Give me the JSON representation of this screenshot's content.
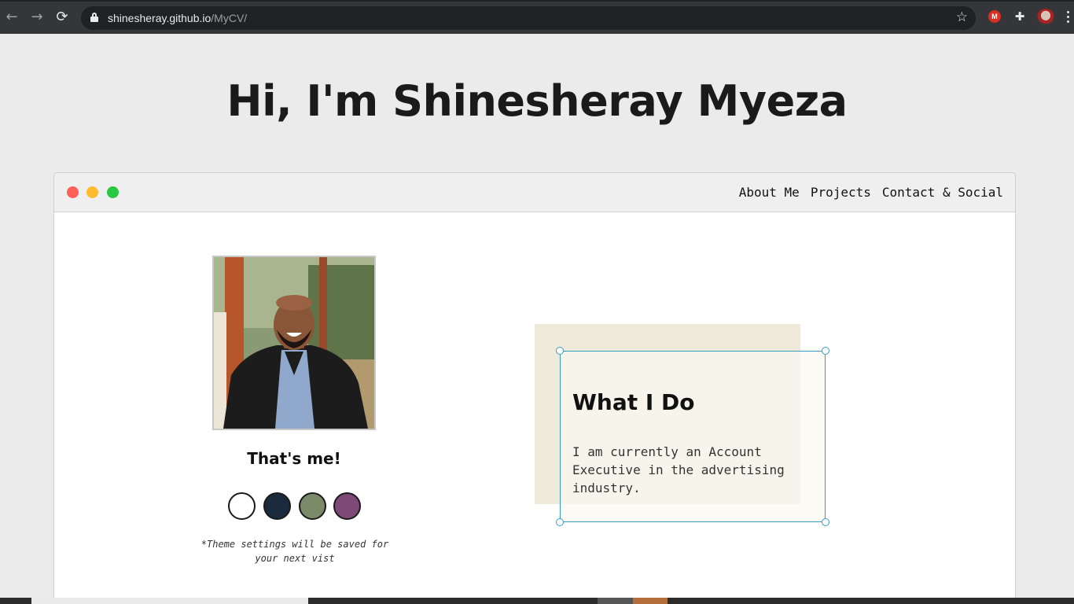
{
  "browser": {
    "url_host": "shinesheray.github.io",
    "url_path": "/MyCV/",
    "back_icon": "arrow-left",
    "forward_icon": "arrow-right",
    "reload_icon": "reload",
    "star_icon": "star-outline",
    "extensions": [
      "m-extension-icon",
      "puzzle-icon",
      "profile-avatar"
    ]
  },
  "page": {
    "title": "Hi, I'm Shinesheray Myeza"
  },
  "window": {
    "traffic_lights": [
      "#fe5f57",
      "#febc2e",
      "#28c840"
    ],
    "nav": [
      {
        "label": "About Me"
      },
      {
        "label": "Projects"
      },
      {
        "label": "Contact & Social"
      }
    ]
  },
  "profile": {
    "caption": "That's me!",
    "theme_swatches": [
      {
        "name": "light",
        "color": "#ffffff"
      },
      {
        "name": "blue",
        "color": "#1b2a3c"
      },
      {
        "name": "green",
        "color": "#7b8a68"
      },
      {
        "name": "purple",
        "color": "#7d4a78"
      }
    ],
    "theme_note": "*Theme settings will be saved for your next vist"
  },
  "what_i_do": {
    "title": "What I Do",
    "text": "I am currently an Account Executive in the advertising industry.",
    "accent_color": "#3a9bbf"
  }
}
